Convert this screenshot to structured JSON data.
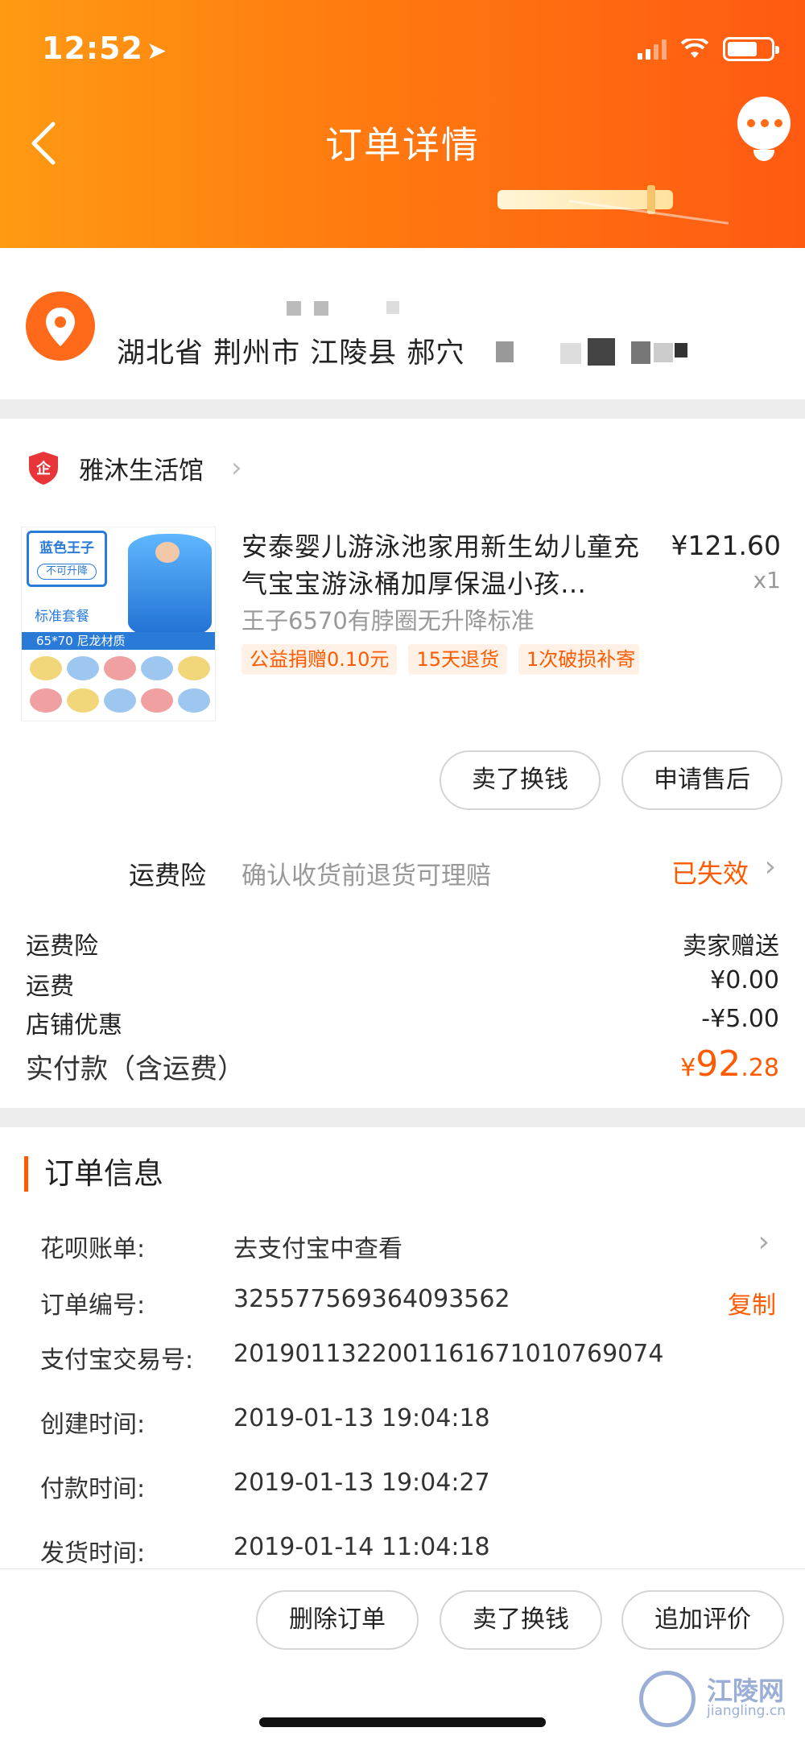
{
  "status_bar": {
    "time": "12:52",
    "location_arrow": "location-arrow-icon"
  },
  "header": {
    "title": "订单详情",
    "back_icon": "back-chevron-icon",
    "chat_icon": "chat-bubble-icon"
  },
  "address": {
    "text": "湖北省 荆州市 江陵县 郝穴"
  },
  "shop": {
    "name": "雅沐生活馆",
    "badge_icon": "enterprise-shield-icon"
  },
  "product": {
    "title": "安泰婴儿游泳池家用新生幼儿童充气宝宝游泳桶加厚保温小孩…",
    "price": "¥121.60",
    "quantity": "x1",
    "sku": "王子6570有脖圈无升降标准",
    "image_texts": {
      "badge_title": "蓝色王子",
      "badge_sub": "不可升降",
      "set": "标准套餐",
      "size": "65*70 尼龙材质"
    },
    "tags": [
      "公益捐赠0.10元",
      "15天退货",
      "1次破损补寄"
    ]
  },
  "product_actions": {
    "sell": "卖了换钱",
    "after_sale": "申请售后"
  },
  "insurance": {
    "label": "运费险",
    "desc": "确认收货前退货可理赔",
    "status": "已失效"
  },
  "fees": [
    {
      "label": "运费险",
      "value": "卖家赠送"
    },
    {
      "label": "运费",
      "value": "¥0.00"
    },
    {
      "label": "店铺优惠",
      "value": "-¥5.00"
    }
  ],
  "total": {
    "label": "实付款（含运费）",
    "currency": "¥",
    "integer": "92",
    "decimal": ".28"
  },
  "order_info": {
    "title": "订单信息",
    "huabei": {
      "label": "花呗账单:",
      "value": "去支付宝中查看"
    },
    "order_no": {
      "label": "订单编号:",
      "value": "325577569364093562",
      "action": "复制"
    },
    "alipay_no": {
      "label": "支付宝交易号:",
      "value": "2019011322001161671010769074"
    },
    "created": {
      "label": "创建时间:",
      "value": "2019-01-13 19:04:18"
    },
    "paid": {
      "label": "付款时间:",
      "value": "2019-01-13 19:04:27"
    },
    "shipped": {
      "label": "发货时间:",
      "value": "2019-01-14 11:04:18"
    }
  },
  "bottom_actions": {
    "delete": "删除订单",
    "sell": "卖了换钱",
    "review": "追加评价"
  },
  "watermark": {
    "title": "江陵网",
    "site": "jiangling.cn"
  },
  "colors": {
    "accent": "#ff5a00",
    "header_start": "#ff9a12",
    "header_end": "#ff5a12"
  }
}
